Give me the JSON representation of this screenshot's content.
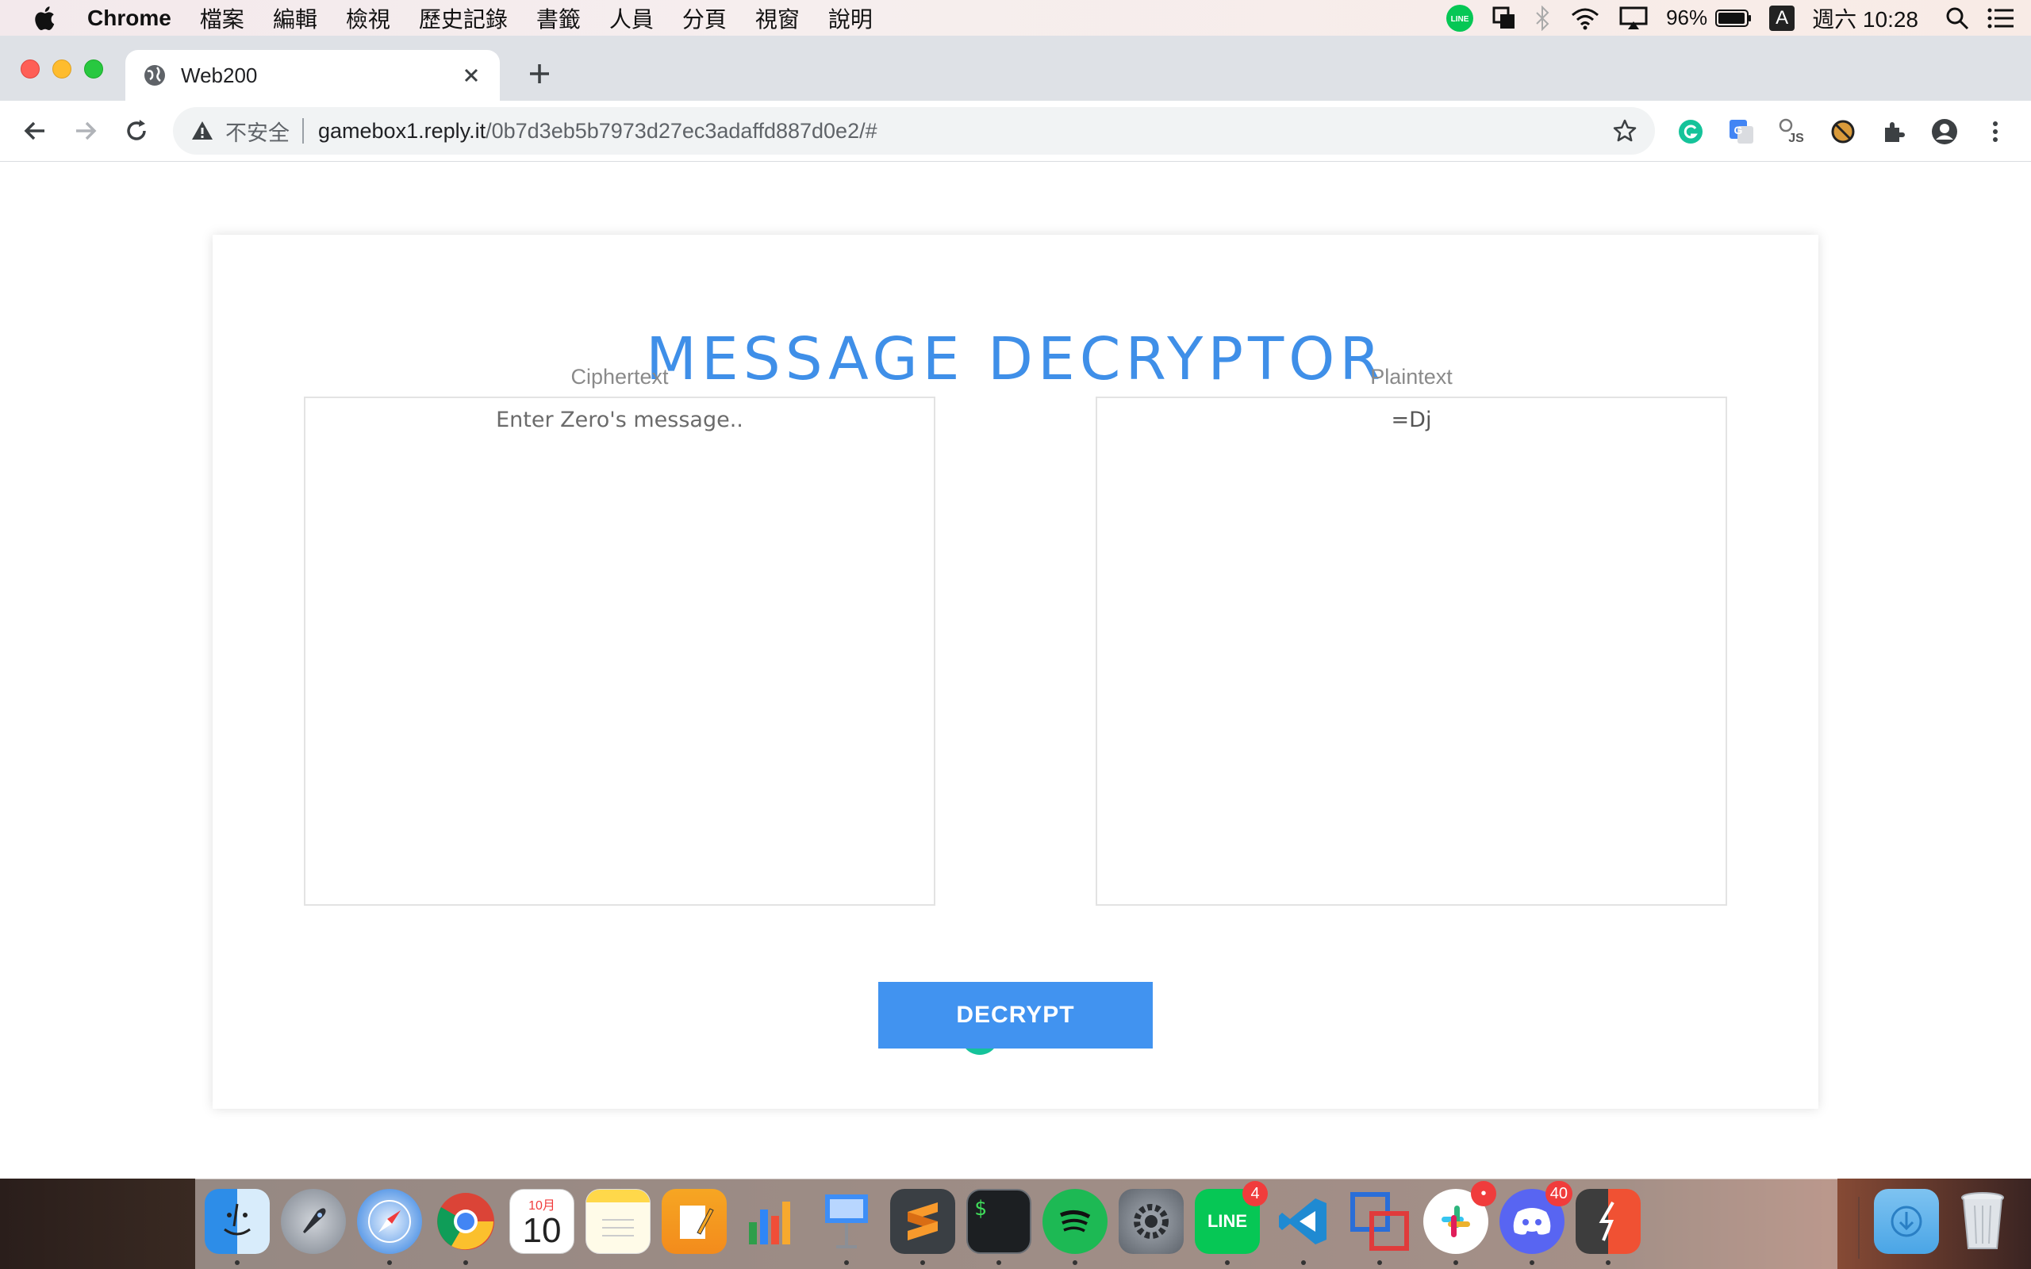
{
  "menubar": {
    "items": [
      "Chrome",
      "檔案",
      "編輯",
      "檢視",
      "歷史記錄",
      "書籤",
      "人員",
      "分頁",
      "視窗",
      "說明"
    ],
    "battery": "96%",
    "input_source": "A",
    "clock": "週六 10:28"
  },
  "browser": {
    "tab_title": "Web200",
    "security_label": "不安全",
    "url_host": "gamebox1.reply.it",
    "url_path": "/0b7d3eb5b7973d27ec3adaffd887d0e2/#"
  },
  "page": {
    "title": "MESSAGE DECRYPTOR",
    "ciphertext_label": "Ciphertext",
    "ciphertext_placeholder": "Enter Zero's message..",
    "plaintext_label": "Plaintext",
    "plaintext_value": "=Dj",
    "decrypt_button": "DECRYPT",
    "accent_color": "#3f8fe8"
  },
  "dock": {
    "apps": [
      {
        "name": "Finder",
        "icon": "finder-icon"
      },
      {
        "name": "Launchpad",
        "icon": "rocket-icon"
      },
      {
        "name": "Safari",
        "icon": "compass-icon"
      },
      {
        "name": "Chrome",
        "icon": "chrome-icon"
      },
      {
        "name": "Calendar",
        "icon": "calendar-icon",
        "month": "10月",
        "day": "10"
      },
      {
        "name": "Notes",
        "icon": "notes-icon"
      },
      {
        "name": "Pages",
        "icon": "pages-icon"
      },
      {
        "name": "Numbers",
        "icon": "numbers-icon"
      },
      {
        "name": "Keynote",
        "icon": "keynote-icon"
      },
      {
        "name": "Sublime Text",
        "icon": "sublime-icon"
      },
      {
        "name": "Terminal",
        "icon": "terminal-icon",
        "label": "$"
      },
      {
        "name": "Spotify",
        "icon": "spotify-icon"
      },
      {
        "name": "System Preferences",
        "icon": "gear-icon"
      },
      {
        "name": "LINE",
        "icon": "line-icon",
        "label": "LINE",
        "badge": "4"
      },
      {
        "name": "VS Code",
        "icon": "vscode-icon"
      },
      {
        "name": "Parallels",
        "icon": "parallels-icon"
      },
      {
        "name": "Slack",
        "icon": "slack-icon",
        "badge": "•"
      },
      {
        "name": "Discord",
        "icon": "discord-icon",
        "badge": "40"
      },
      {
        "name": "Git",
        "icon": "git-icon"
      },
      {
        "name": "Downloads",
        "icon": "downloads-folder-icon"
      },
      {
        "name": "Trash",
        "icon": "trash-icon"
      }
    ]
  }
}
